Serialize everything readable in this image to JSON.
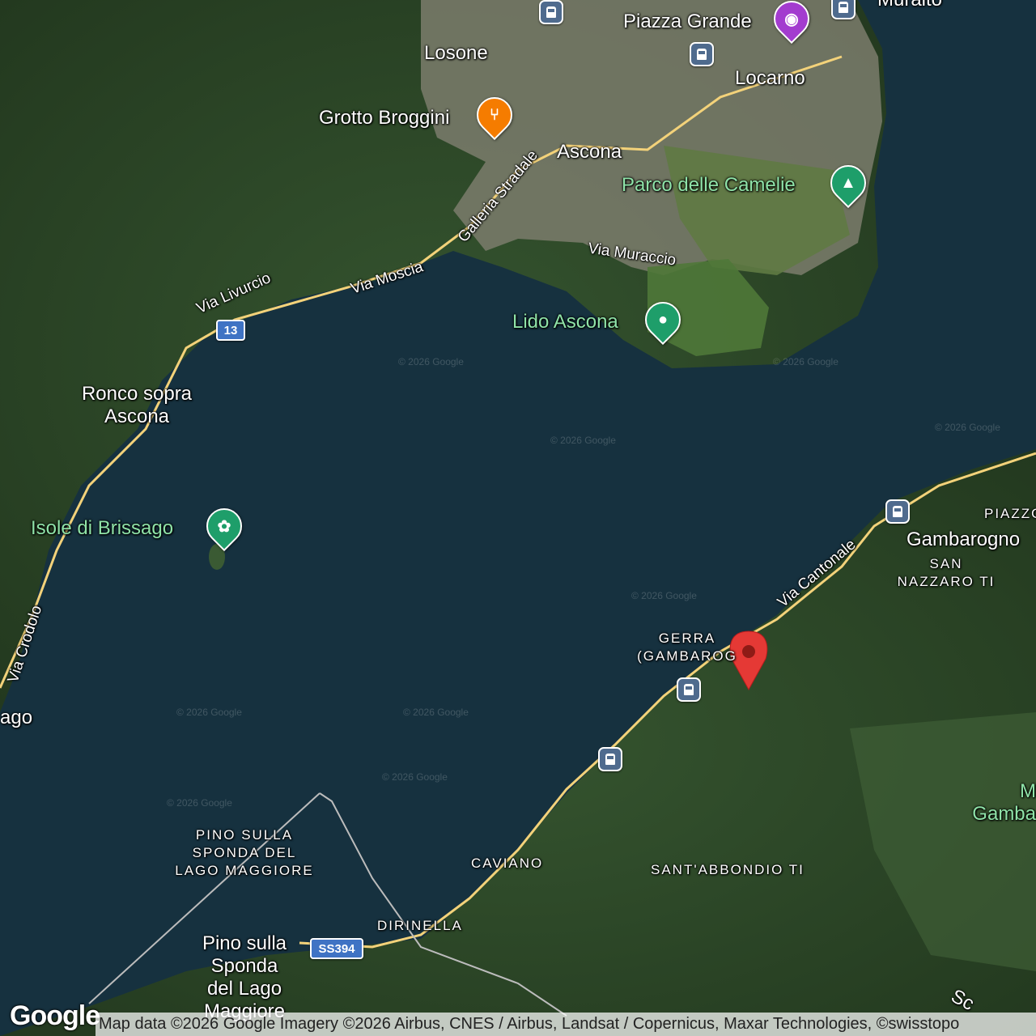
{
  "colors": {
    "water": "#16313f",
    "forest": "#2d4a2a",
    "urban": "#8a8a78",
    "marker": "#e53935",
    "poi_green": "#1e9e6a",
    "food": "#f57c00",
    "photo": "#a33ccf",
    "transit": "#4f6b8e",
    "road": "#f3d27a"
  },
  "places": {
    "losone": "Losone",
    "locarno": "Locarno",
    "ascona": "Ascona",
    "piazza_grande": "Piazza Grande",
    "grotto_broggini": "Grotto Broggini",
    "parco_camelie": "Parco delle Camelie",
    "lido_ascona": "Lido Ascona",
    "ronco": "Ronco sopra\nAscona",
    "isole_brissago": "Isole di Brissago",
    "brissago_partial": "ago",
    "gambarogno": "Gambarogno",
    "san_nazzaro": "SAN\nNAZZARO TI",
    "piazzogna_partial": "PIAZZO",
    "gerra": "GERRA\n(GAMBAROG",
    "caviano": "CAVIANO",
    "sant_abbondio": "SANT'ABBONDIO TI",
    "dirinella": "DIRINELLA",
    "pino_caps": "PINO SULLA\nSPONDA DEL\nLAGO MAGGIORE",
    "pino": "Pino sulla\nSponda\ndel Lago\nMaggiore",
    "muralto_partial": "Muralto",
    "gamba_partial": "M\nGamba",
    "sc_partial": "Sc"
  },
  "roads": {
    "via_livurcio": "Via Livurcio",
    "via_moscia": "Via Moscia",
    "galleria": "Galleria Stradale",
    "via_muraccio": "Via Muraccio",
    "via_cantonale": "Via Cantonale",
    "via_crodolo": "Via Crodolo",
    "route_13": "13",
    "ss394": "SS394"
  },
  "icons": {
    "food": "restaurant-icon",
    "park": "tree-icon",
    "beach": "lido-icon",
    "garden": "flower-icon",
    "photo": "camera-icon",
    "train": "train-icon",
    "marker": "location-pin-icon"
  },
  "watermark": "© 2026 Google",
  "footer": {
    "logo": "Google",
    "attribution": "Map data ©2026 Google Imagery ©2026 Airbus, CNES / Airbus, Landsat / Copernicus, Maxar Technologies, ©swisstopo"
  }
}
